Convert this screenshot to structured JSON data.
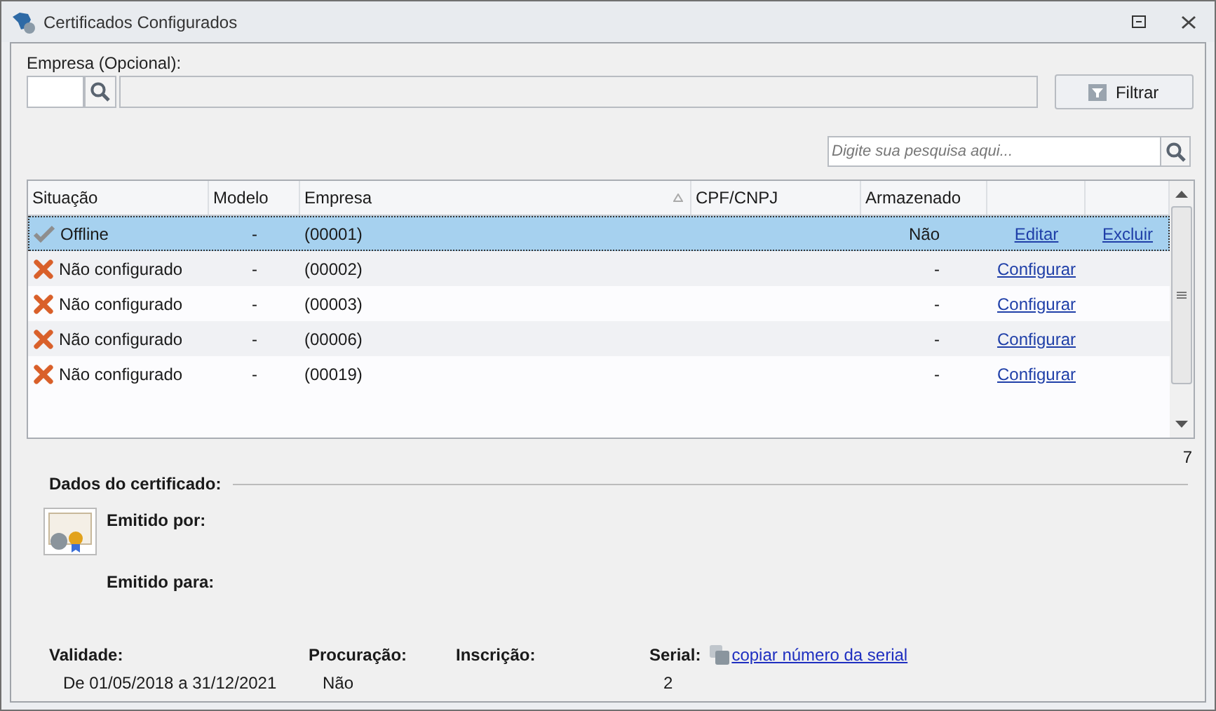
{
  "window": {
    "title": "Certificados Configurados"
  },
  "company_filter": {
    "label": "Empresa (Opcional):",
    "filter_button": "Filtrar"
  },
  "search": {
    "placeholder": "Digite sua pesquisa aqui..."
  },
  "table": {
    "columns": [
      {
        "label": "Situação",
        "sorted": false
      },
      {
        "label": "Modelo",
        "sorted": false
      },
      {
        "label": "Empresa",
        "sorted": true
      },
      {
        "label": "CPF/CNPJ",
        "sorted": false
      },
      {
        "label": "Armazenado",
        "sorted": false
      }
    ],
    "rows": [
      {
        "status": {
          "kind": "check",
          "text": "Offline"
        },
        "modelo": "-",
        "empresa": "(00001)",
        "armazenado": "Não",
        "actions": [
          "Editar",
          "Excluir"
        ],
        "selected": true
      },
      {
        "status": {
          "kind": "cross",
          "text": "Não configurado"
        },
        "modelo": "-",
        "empresa": "(00002)",
        "armazenado": "-",
        "actions": [
          "Configurar"
        ],
        "selected": false
      },
      {
        "status": {
          "kind": "cross",
          "text": "Não configurado"
        },
        "modelo": "-",
        "empresa": "(00003)",
        "armazenado": "-",
        "actions": [
          "Configurar"
        ],
        "selected": false
      },
      {
        "status": {
          "kind": "cross",
          "text": "Não configurado"
        },
        "modelo": "-",
        "empresa": "(00006)",
        "armazenado": "-",
        "actions": [
          "Configurar"
        ],
        "selected": false
      },
      {
        "status": {
          "kind": "cross",
          "text": "Não configurado"
        },
        "modelo": "-",
        "empresa": "(00019)",
        "armazenado": "-",
        "actions": [
          "Configurar"
        ],
        "selected": false
      }
    ],
    "count": "7"
  },
  "certificate": {
    "title": "Dados do certificado:",
    "issued_by_label": "Emitido por:",
    "issued_to_label": "Emitido para:",
    "fields": [
      {
        "label": "Validade:",
        "value": "De 01/05/2018 a 31/12/2021"
      },
      {
        "label": "Procuração:",
        "value": "Não"
      },
      {
        "label": "Inscrição:"
      },
      {
        "label": "Serial:",
        "value": "2",
        "link": "copiar número da serial"
      }
    ]
  }
}
